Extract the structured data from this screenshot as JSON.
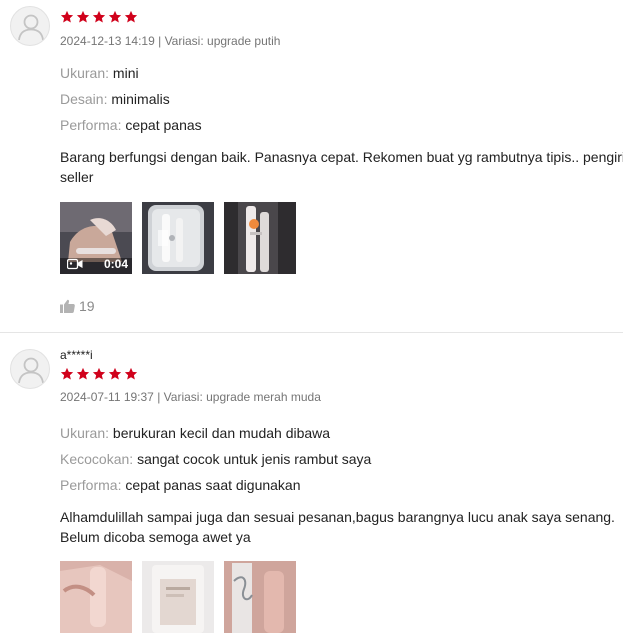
{
  "reviews": [
    {
      "username": "",
      "rating": 5,
      "timestamp": "2024-12-13 14:19",
      "separator": "|",
      "variation": "Variasi: upgrade putih",
      "attributes": [
        {
          "key": "Ukuran:",
          "value": "mini"
        },
        {
          "key": "Desain:",
          "value": "minimalis"
        },
        {
          "key": "Performa:",
          "value": "cepat panas"
        }
      ],
      "text_line1": "Barang berfungsi dengan baik. Panasnya cepat. Rekomen buat yg rambutnya tipis.. pengirim",
      "text_line2": "seller",
      "media": [
        {
          "type": "video",
          "duration": "0:04"
        },
        {
          "type": "image"
        },
        {
          "type": "image"
        }
      ],
      "likes": "19"
    },
    {
      "username": "a*****i",
      "rating": 5,
      "timestamp": "2024-07-11 19:37",
      "separator": "|",
      "variation": "Variasi: upgrade merah muda",
      "attributes": [
        {
          "key": "Ukuran:",
          "value": "berukuran kecil dan mudah dibawa"
        },
        {
          "key": "Kecocokan:",
          "value": "sangat cocok untuk jenis rambut saya"
        },
        {
          "key": "Performa:",
          "value": "cepat panas saat digunakan"
        }
      ],
      "text_line1": "Alhamdulillah sampai juga dan sesuai pesanan,bagus barangnya lucu anak saya senang.",
      "text_line2": "Belum dicoba semoga awet ya",
      "media": [
        {
          "type": "image"
        },
        {
          "type": "image"
        },
        {
          "type": "image"
        }
      ]
    }
  ],
  "colors": {
    "star": "#d0011b",
    "meta_text": "#757575",
    "attribute_key": "#9a9a9a",
    "divider": "#e5e5e5"
  },
  "icons": {
    "star": "star-icon",
    "video": "video-camera-icon",
    "like": "thumbs-up-icon",
    "avatar": "user-silhouette-icon"
  }
}
